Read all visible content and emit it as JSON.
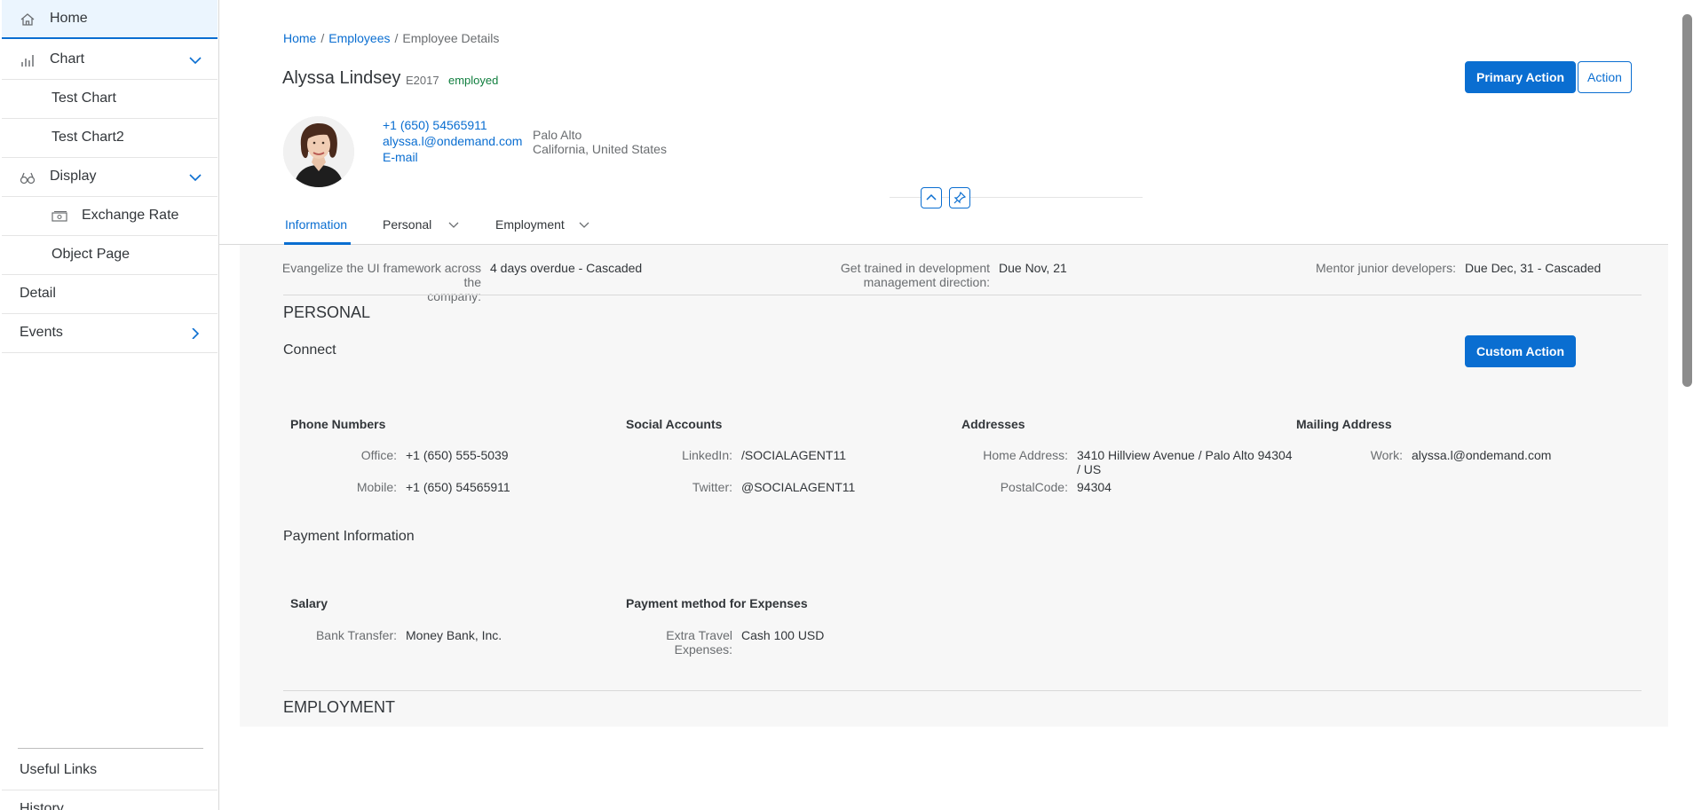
{
  "sidebar": {
    "items": [
      {
        "label": "Home",
        "icon": "home-icon"
      },
      {
        "label": "Chart",
        "icon": "bar-chart-icon"
      },
      {
        "label": "Test Chart"
      },
      {
        "label": "Test Chart2"
      },
      {
        "label": "Display",
        "icon": "binoculars-icon"
      },
      {
        "label": "Exchange Rate",
        "icon": "money-bills-icon"
      },
      {
        "label": "Object Page"
      },
      {
        "label": "Detail"
      },
      {
        "label": "Events"
      }
    ],
    "footer": [
      {
        "label": "Useful Links"
      },
      {
        "label": "History"
      }
    ]
  },
  "breadcrumb": {
    "home": "Home",
    "employees": "Employees",
    "separator": "/",
    "current": "Employee Details"
  },
  "header": {
    "name": "Alyssa Lindsey",
    "id": "E2017",
    "status": "employed",
    "primary_action": "Primary Action",
    "action": "Action",
    "phone": "+1 (650) 54565911",
    "email": "alyssa.l@ondemand.com",
    "email_link": "E-mail",
    "city": "Palo Alto",
    "region": "California, United States"
  },
  "tabs": [
    {
      "label": "Information"
    },
    {
      "label": "Personal"
    },
    {
      "label": "Employment"
    }
  ],
  "kpis": [
    {
      "label_line1": "Evangelize the UI framework across the",
      "label_line2": "company:",
      "value": "4 days overdue - Cascaded"
    },
    {
      "label_line1": "Get trained in development",
      "label_line2": "management direction:",
      "value": "Due Nov, 21"
    },
    {
      "label_line1": "Mentor junior developers:",
      "label_line2": "",
      "value": "Due Dec, 31 - Cascaded"
    }
  ],
  "personal": {
    "title": "PERSONAL",
    "connect": {
      "title": "Connect",
      "custom_action": "Custom Action",
      "phone_numbers": {
        "title": "Phone Numbers",
        "office_label": "Office:",
        "office_value": "+1 (650) 555-5039",
        "mobile_label": "Mobile:",
        "mobile_value": "+1 (650) 54565911"
      },
      "social_accounts": {
        "title": "Social Accounts",
        "linkedin_label": "LinkedIn:",
        "linkedin_value": "/SOCIALAGENT11",
        "twitter_label": "Twitter:",
        "twitter_value": "@SOCIALAGENT11"
      },
      "addresses": {
        "title": "Addresses",
        "home_label": "Home Address:",
        "home_value_line1": "3410 Hillview Avenue / Palo Alto 94304",
        "home_value_line2": "/ US",
        "postal_label": "PostalCode:",
        "postal_value": "94304"
      },
      "mailing_address": {
        "title": "Mailing Address",
        "work_label": "Work:",
        "work_value": "alyssa.l@ondemand.com"
      }
    },
    "payment": {
      "title": "Payment Information",
      "salary": {
        "title": "Salary",
        "bank_label": "Bank Transfer:",
        "bank_value": "Money Bank, Inc."
      },
      "expenses": {
        "title": "Payment method for Expenses",
        "travel_label_line1": "Extra Travel",
        "travel_label_line2": "Expenses:",
        "travel_value": "Cash 100 USD"
      }
    }
  },
  "employment": {
    "title": "EMPLOYMENT"
  },
  "colors": {
    "accent": "#0a6ed1",
    "positive": "#107e3e",
    "selected_bg": "#ebf5fe",
    "section_bg": "#f7f7f7"
  }
}
